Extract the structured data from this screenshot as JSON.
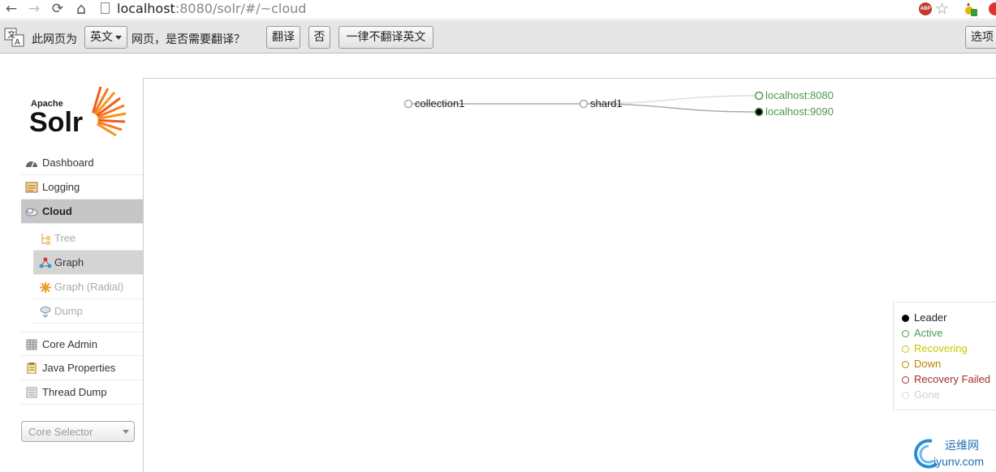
{
  "browser": {
    "url_host": "localhost",
    "url_rest": ":8080/solr/#/~cloud",
    "back_icon": "←",
    "forward_icon": "→",
    "reload_icon": "⟳",
    "home_icon": "⌂",
    "abp_label": "ABP",
    "star_icon": "☆"
  },
  "translate_bar": {
    "prompt_prefix": "此网页为",
    "language": "英文",
    "prompt_suffix": "网页，是否需要翻译？",
    "translate_button": "翻译",
    "no_button": "否",
    "never_button": "一律不翻译英文",
    "options_button": "选项"
  },
  "logo": {
    "apache": "Apache",
    "solr": "Solr"
  },
  "nav": {
    "items": [
      {
        "label": "Dashboard",
        "icon": "dashboard-icon"
      },
      {
        "label": "Logging",
        "icon": "logging-icon"
      },
      {
        "label": "Cloud",
        "icon": "cloud-icon",
        "active": true
      },
      {
        "label": "Core Admin",
        "icon": "core-admin-icon"
      },
      {
        "label": "Java Properties",
        "icon": "java-properties-icon"
      },
      {
        "label": "Thread Dump",
        "icon": "thread-dump-icon"
      }
    ],
    "cloud_sub": [
      {
        "label": "Tree",
        "icon": "tree-icon"
      },
      {
        "label": "Graph",
        "icon": "graph-icon",
        "selected": true
      },
      {
        "label": "Graph (Radial)",
        "icon": "graph-radial-icon"
      },
      {
        "label": "Dump",
        "icon": "dump-icon"
      }
    ]
  },
  "core_selector": {
    "placeholder": "Core Selector"
  },
  "graph": {
    "collection": "collection1",
    "shard": "shard1",
    "replicas": [
      {
        "name": "localhost:8080",
        "state": "active"
      },
      {
        "name": "localhost:9090",
        "state": "leader"
      }
    ]
  },
  "legend": [
    {
      "label": "Leader",
      "color": "#000000"
    },
    {
      "label": "Active",
      "color": "#4e9a4e"
    },
    {
      "label": "Recovering",
      "color": "#c8c800"
    },
    {
      "label": "Down",
      "color": "#c08000"
    },
    {
      "label": "Recovery Failed",
      "color": "#a0322a"
    },
    {
      "label": "Gone",
      "color": "#d8d8d8"
    }
  ],
  "watermark": {
    "line1": "运维网",
    "line2": "iyunv.com"
  }
}
